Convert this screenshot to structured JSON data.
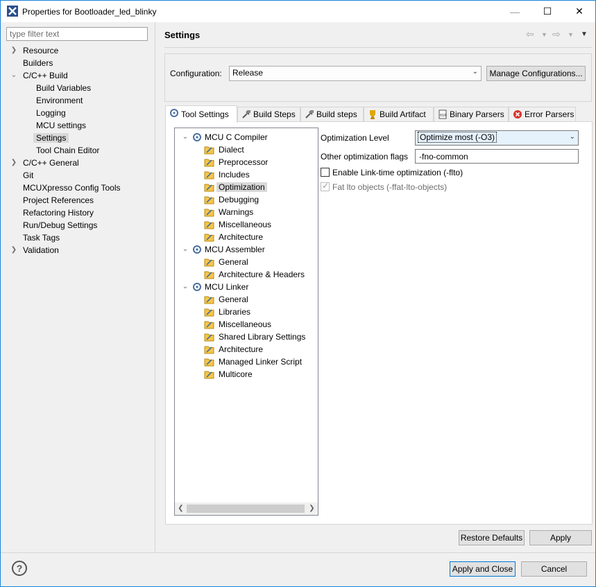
{
  "window": {
    "title": "Properties for Bootloader_led_blinky",
    "minimize_glyph": "—",
    "maximize_glyph": "☐",
    "close_glyph": "✕"
  },
  "filter": {
    "placeholder": "type filter text"
  },
  "nav": [
    {
      "label": "Resource",
      "expandable": true,
      "expanded": false
    },
    {
      "label": "Builders"
    },
    {
      "label": "C/C++ Build",
      "expandable": true,
      "expanded": true
    },
    {
      "label": "Build Variables",
      "indent": 1
    },
    {
      "label": "Environment",
      "indent": 1
    },
    {
      "label": "Logging",
      "indent": 1
    },
    {
      "label": "MCU settings",
      "indent": 1
    },
    {
      "label": "Settings",
      "indent": 1,
      "selected": true
    },
    {
      "label": "Tool Chain Editor",
      "indent": 1
    },
    {
      "label": "C/C++ General",
      "expandable": true,
      "expanded": false
    },
    {
      "label": "Git"
    },
    {
      "label": "MCUXpresso Config Tools"
    },
    {
      "label": "Project References"
    },
    {
      "label": "Refactoring History"
    },
    {
      "label": "Run/Debug Settings"
    },
    {
      "label": "Task Tags"
    },
    {
      "label": "Validation",
      "expandable": true,
      "expanded": false
    }
  ],
  "header": {
    "title": "Settings"
  },
  "config": {
    "label": "Configuration:",
    "value": "Release",
    "manage_label": "Manage Configurations..."
  },
  "tabs": [
    {
      "label": "Tool Settings",
      "icon": "tool-settings-icon",
      "active": true
    },
    {
      "label": "Build Steps",
      "icon": "build-steps-icon"
    },
    {
      "label": "Build steps",
      "icon": "build-steps-icon"
    },
    {
      "label": "Build Artifact",
      "icon": "build-artifact-icon"
    },
    {
      "label": "Binary Parsers",
      "icon": "binary-parsers-icon"
    },
    {
      "label": "Error Parsers",
      "icon": "error-parsers-icon"
    }
  ],
  "tool_tree": [
    {
      "label": "MCU C Compiler",
      "level": 0,
      "expanded": true
    },
    {
      "label": "Dialect",
      "level": 1
    },
    {
      "label": "Preprocessor",
      "level": 1
    },
    {
      "label": "Includes",
      "level": 1
    },
    {
      "label": "Optimization",
      "level": 1,
      "selected": true
    },
    {
      "label": "Debugging",
      "level": 1
    },
    {
      "label": "Warnings",
      "level": 1
    },
    {
      "label": "Miscellaneous",
      "level": 1
    },
    {
      "label": "Architecture",
      "level": 1
    },
    {
      "label": "MCU Assembler",
      "level": 0,
      "expanded": true
    },
    {
      "label": "General",
      "level": 1
    },
    {
      "label": "Architecture & Headers",
      "level": 1
    },
    {
      "label": "MCU Linker",
      "level": 0,
      "expanded": true
    },
    {
      "label": "General",
      "level": 1
    },
    {
      "label": "Libraries",
      "level": 1
    },
    {
      "label": "Miscellaneous",
      "level": 1
    },
    {
      "label": "Shared Library Settings",
      "level": 1
    },
    {
      "label": "Architecture",
      "level": 1
    },
    {
      "label": "Managed Linker Script",
      "level": 1
    },
    {
      "label": "Multicore",
      "level": 1
    }
  ],
  "options": {
    "opt_level_label": "Optimization Level",
    "opt_level_value": "Optimize most (-O3)",
    "other_flags_label": "Other optimization flags",
    "other_flags_value": "-fno-common",
    "lto_label": "Enable Link-time optimization (-flto)",
    "lto_checked": false,
    "fat_lto_label": "Fat lto objects (-ffat-lto-objects)",
    "fat_lto_checked": true,
    "fat_lto_disabled": true
  },
  "buttons": {
    "restore_defaults": "Restore Defaults",
    "apply": "Apply",
    "apply_close": "Apply and Close",
    "cancel": "Cancel",
    "help": "?"
  },
  "colors": {
    "accent_border": "#1883d7",
    "selection": "#d9d9d9",
    "dropdown_focus": "#e5f1fb"
  }
}
